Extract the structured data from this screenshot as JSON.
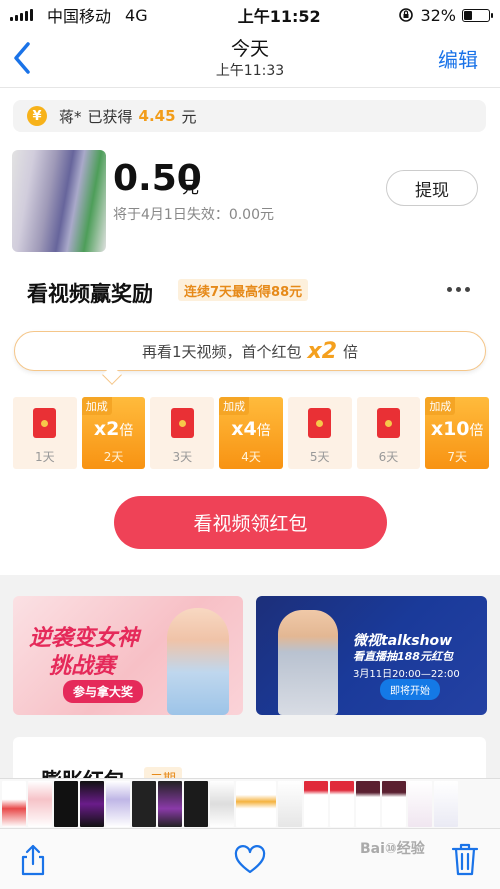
{
  "status_bar": {
    "carrier": "中国移动",
    "network": "4G",
    "time": "上午11:52",
    "battery": "32%",
    "battery_level": 0.32
  },
  "nav": {
    "title": "今天",
    "subtitle": "上午11:33",
    "edit_label": "编辑"
  },
  "earned": {
    "yen_symbol": "¥",
    "user": "蒋*",
    "label": "已获得",
    "amount": "4.45",
    "unit": "元"
  },
  "balance": {
    "amount": "0.50",
    "unit": "元",
    "expire_text": "将于4月1日失效：0.00元",
    "withdraw_label": "提现"
  },
  "reward": {
    "title": "看视频赢奖励",
    "tag": "连续7天最高得88元",
    "bubble_prefix": "再看1天视频，首个红包",
    "bubble_mult": "x2",
    "bubble_suffix": "倍",
    "days": [
      {
        "label": "1天"
      },
      {
        "label": "2天",
        "badge": "加成",
        "mult": "x2",
        "unit": "倍"
      },
      {
        "label": "3天"
      },
      {
        "label": "4天",
        "badge": "加成",
        "mult": "x4",
        "unit": "倍"
      },
      {
        "label": "5天"
      },
      {
        "label": "6天"
      },
      {
        "label": "7天",
        "badge": "加成",
        "mult": "x10",
        "unit": "倍"
      }
    ],
    "cta_label": "看视频领红包"
  },
  "banners": {
    "left": {
      "line1": "逆袭变女神",
      "line2": "挑战赛",
      "button": "参与拿大奖"
    },
    "right": {
      "line1": "微视talkshow",
      "line2": "看直播抽188元红包",
      "line3": "3月11日20:00—22:00",
      "button": "即将开始"
    }
  },
  "section2": {
    "title": "膨胀红包",
    "tag": "二期"
  },
  "toolbar": {
    "watermark": "Bai⑩经验"
  },
  "colors": {
    "accent_blue": "#1a73e8",
    "cta_red": "#ef4257",
    "gold": "#f29d1a"
  }
}
